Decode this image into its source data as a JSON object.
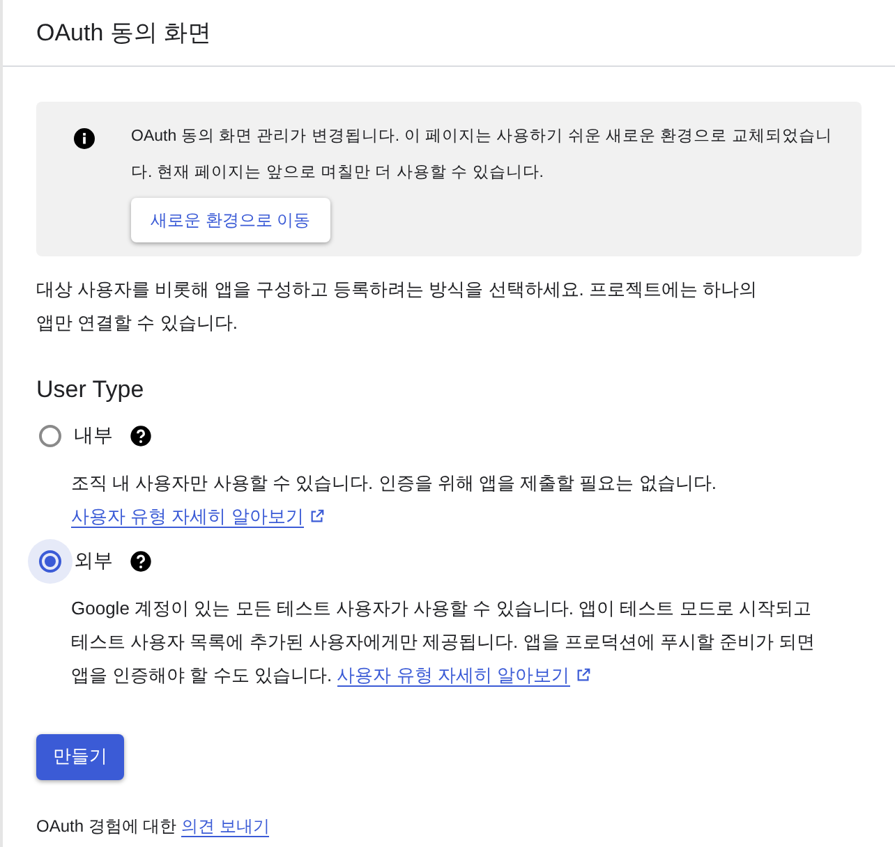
{
  "header": {
    "title": "OAuth 동의 화면"
  },
  "notice": {
    "text": "OAuth 동의 화면 관리가 변경됩니다. 이 페이지는 사용하기 쉬운 새로운 환경으로 교체되었습니다. 현재 페이지는 앞으로 며칠만 더 사용할 수 있습니다.",
    "button": "새로운 환경으로 이동"
  },
  "intro": "대상 사용자를 비롯해 앱을 구성하고 등록하려는 방식을 선택하세요. 프로젝트에는 하나의 앱만 연결할 수 있습니다.",
  "user_type": {
    "title": "User Type",
    "options": [
      {
        "label": "내부",
        "selected": false,
        "description": "조직 내 사용자만 사용할 수 있습니다. 인증을 위해 앱을 제출할 필요는 없습니다.",
        "link": "사용자 유형 자세히 알아보기"
      },
      {
        "label": "외부",
        "selected": true,
        "description": "Google 계정이 있는 모든 테스트 사용자가 사용할 수 있습니다. 앱이 테스트 모드로 시작되고 테스트 사용자 목록에 추가된 사용자에게만 제공됩니다. 앱을 프로덕션에 푸시할 준비가 되면 앱을 인증해야 할 수도 있습니다.",
        "link": "사용자 유형 자세히 알아보기"
      }
    ]
  },
  "create_button": "만들기",
  "feedback": {
    "text": "OAuth 경험에 대한",
    "link": "의견 보내기"
  }
}
